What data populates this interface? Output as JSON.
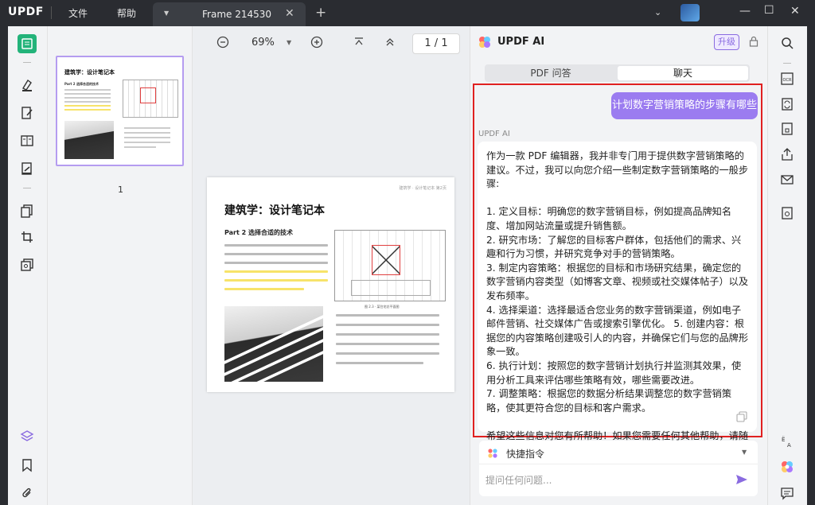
{
  "titlebar": {
    "logo": "UPDF",
    "menu": [
      "文件",
      "帮助"
    ],
    "tab_title": "Frame 214530"
  },
  "thumbnails": {
    "page_number": "1",
    "thumb_title": "建筑学：设计笔记本",
    "thumb_part": "Part 2   选择合适的技术"
  },
  "toolbar": {
    "zoom": "69%",
    "page_indicator": "1 / 1"
  },
  "page": {
    "header": "建筑学 · 设计笔记本 第2页",
    "title": "建筑学：设计笔记本",
    "part": "Part 2   选择合适的技术",
    "figure_caption": "图 2.3 · 某住宅总平面图"
  },
  "ai_panel": {
    "title": "UPDF AI",
    "upgrade_label": "升级",
    "tabs": [
      "PDF 问答",
      "聊天"
    ],
    "active_tab": "聊天",
    "user_message": "计划数字营销策略的步骤有哪些",
    "ai_label": "UPDF AI",
    "ai_response": [
      "作为一款 PDF 编辑器，我并非专门用于提供数字营销策略的建议。不过，我可以向您介绍一些制定数字营销策略的一般步骤:",
      "",
      "  1. 定义目标：明确您的数字营销目标，例如提高品牌知名度、增加网站流量或提升销售额。",
      "  2. 研究市场：了解您的目标客户群体，包括他们的需求、兴趣和行为习惯，并研究竞争对手的营销策略。",
      "  3. 制定内容策略：根据您的目标和市场研究结果，确定您的数字营销内容类型（如博客文章、视频或社交媒体帖子）以及发布频率。",
      "  4. 选择渠道：选择最适合您业务的数字营销渠道，例如电子邮件营销、社交媒体广告或搜索引擎优化。  5. 创建内容：根据您的内容策略创建吸引人的内容，并确保它们与您的品牌形象一致。",
      "  6. 执行计划：按照您的数字营销计划执行并监测其效果，使用分析工具来评估哪些策略有效，哪些需要改进。",
      "  7. 调整策略：根据您的数据分析结果调整您的数字营销策略，使其更符合您的目标和客户需求。",
      "",
      "希望这些信息对您有所帮助！如果您需要任何其他帮助，请随时告诉我。"
    ],
    "quick_commands_label": "快捷指令",
    "input_placeholder": "提问任何问题..."
  },
  "colors": {
    "accent": "#9b7cf0",
    "highlight_box": "#e02020",
    "titlebar": "#2a2c31"
  }
}
